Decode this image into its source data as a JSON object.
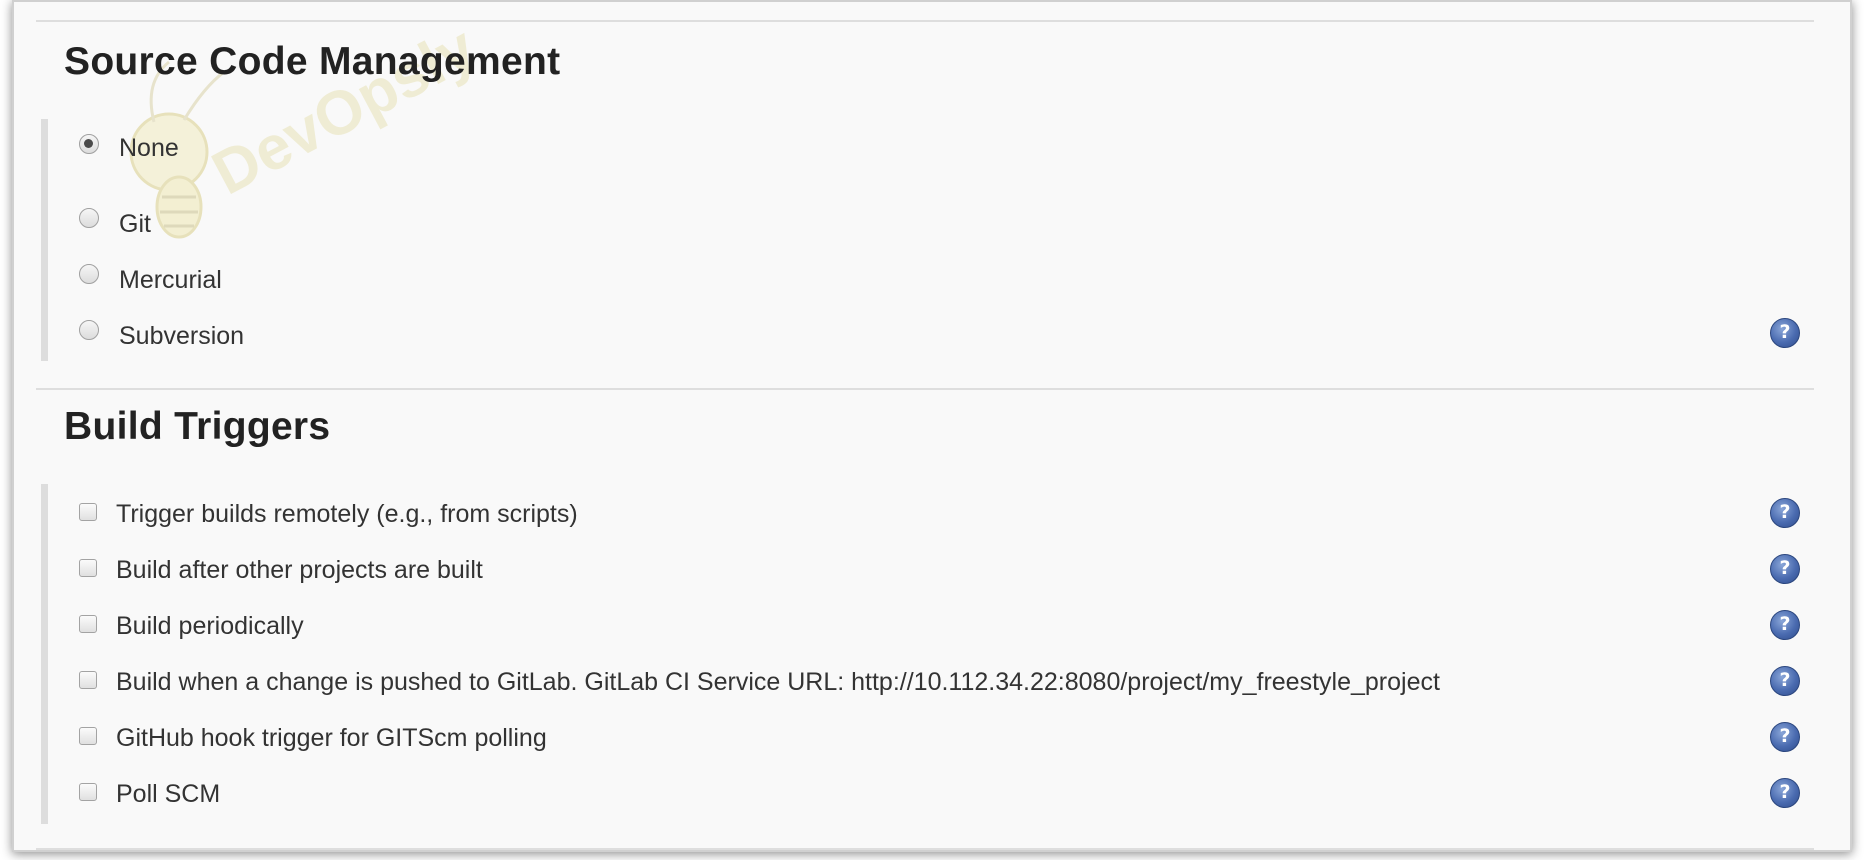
{
  "scm": {
    "title": "Source Code Management",
    "options": [
      {
        "label": "None",
        "checked": true
      },
      {
        "label": "Git",
        "checked": false
      },
      {
        "label": "Mercurial",
        "checked": false
      },
      {
        "label": "Subversion",
        "checked": false
      }
    ],
    "help_glyph": "?"
  },
  "triggers": {
    "title": "Build Triggers",
    "options": [
      {
        "label": "Trigger builds remotely (e.g., from scripts)",
        "checked": false
      },
      {
        "label": "Build after other projects are built",
        "checked": false
      },
      {
        "label": "Build periodically",
        "checked": false
      },
      {
        "label": "Build when a change is pushed to GitLab. GitLab CI Service URL: http://10.112.34.22:8080/project/my_freestyle_project",
        "checked": false
      },
      {
        "label": "GitHub hook trigger for GITScm polling",
        "checked": false
      },
      {
        "label": "Poll SCM",
        "checked": false
      }
    ],
    "help_glyph": "?"
  },
  "watermark": {
    "text": "DevOpsly"
  },
  "colors": {
    "help_icon": "#4a6bb0",
    "background": "#f9f9f9",
    "heading": "#222222"
  }
}
